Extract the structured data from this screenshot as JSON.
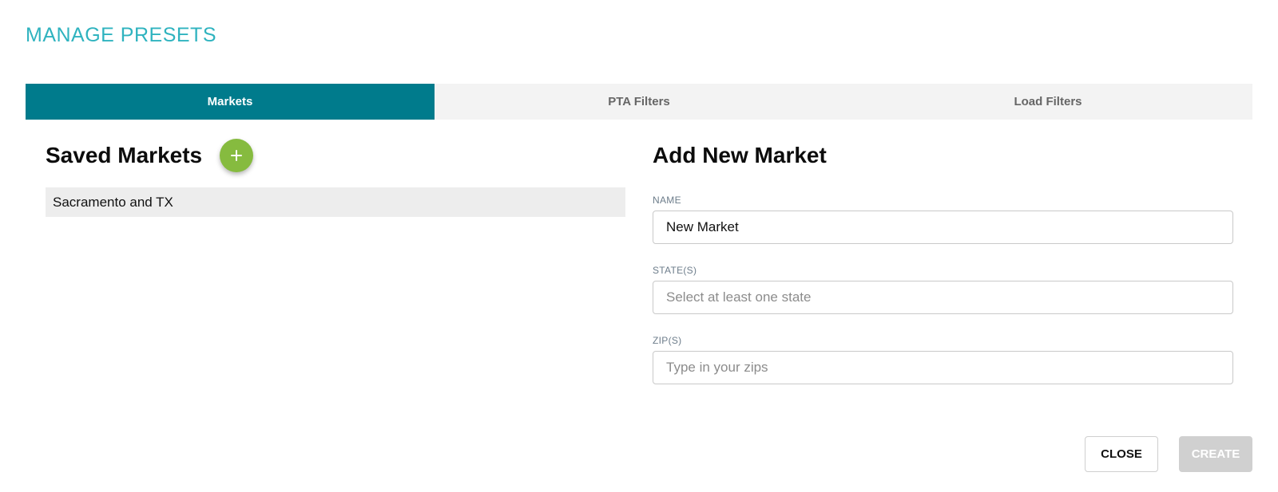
{
  "dialog": {
    "title": "MANAGE PRESETS"
  },
  "tabs": [
    {
      "label": "Markets",
      "active": true
    },
    {
      "label": "PTA Filters",
      "active": false
    },
    {
      "label": "Load Filters",
      "active": false
    }
  ],
  "saved": {
    "heading": "Saved Markets",
    "add_icon": "plus-icon",
    "items": [
      "Sacramento and TX"
    ]
  },
  "form": {
    "heading": "Add New Market",
    "name": {
      "label": "NAME",
      "value": "New Market"
    },
    "states": {
      "label": "STATE(S)",
      "placeholder": "Select at least one state"
    },
    "zips": {
      "label": "ZIP(S)",
      "placeholder": "Type in your zips"
    }
  },
  "actions": {
    "close_label": "CLOSE",
    "create_label": "CREATE"
  },
  "colors": {
    "title": "#2fb3bf",
    "tab_active_bg": "#007b8c",
    "add_button": "#86bb3f",
    "create_disabled": "#d0d0d0"
  }
}
